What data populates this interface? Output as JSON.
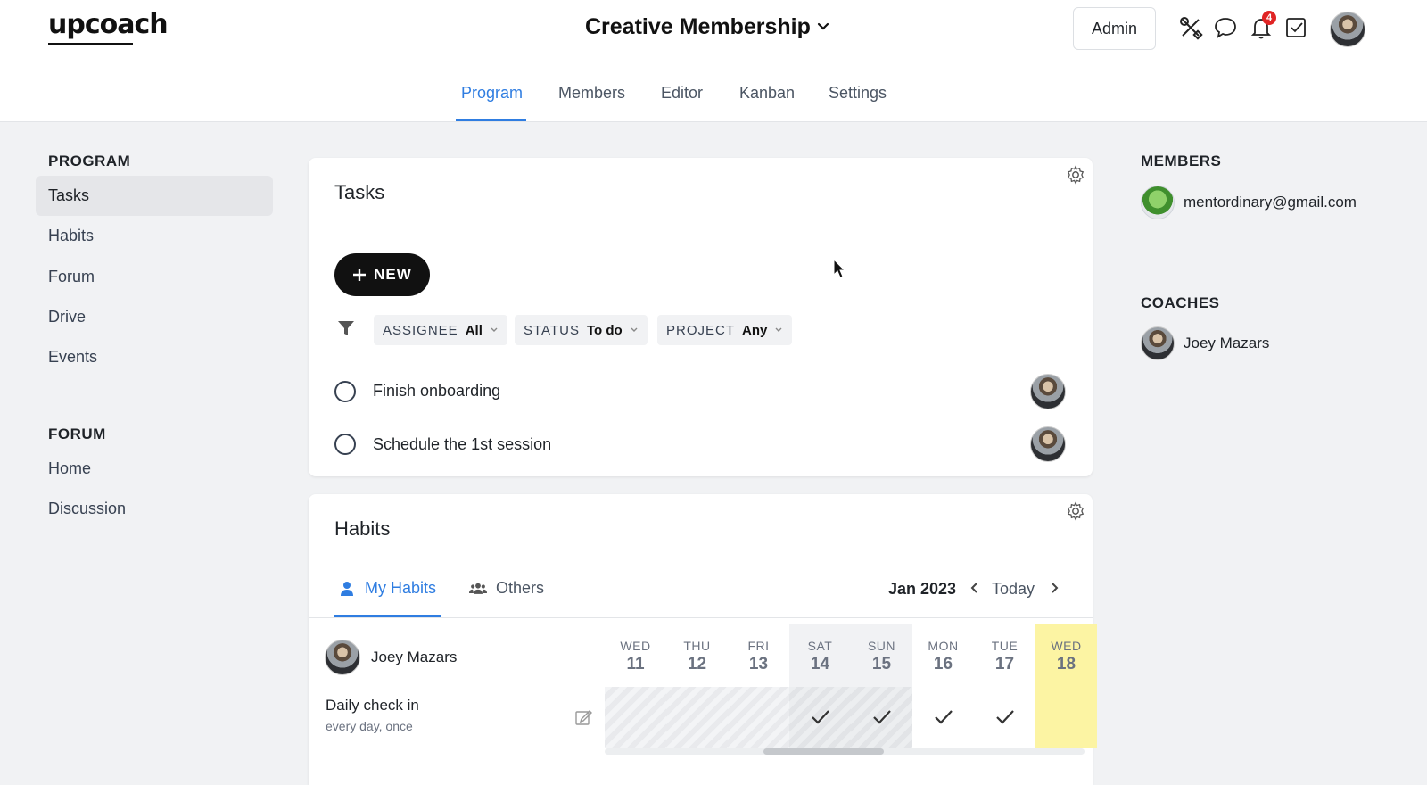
{
  "header": {
    "logo": "upcoach",
    "program_title": "Creative Membership",
    "admin_label": "Admin",
    "notification_count": "4",
    "icons": [
      "tools-icon",
      "chat-icon",
      "bell-icon",
      "checkbox-icon"
    ]
  },
  "nav_tabs": [
    {
      "label": "Program",
      "active": true
    },
    {
      "label": "Members"
    },
    {
      "label": "Editor"
    },
    {
      "label": "Kanban"
    },
    {
      "label": "Settings"
    }
  ],
  "sidebar": {
    "program_heading": "PROGRAM",
    "program_items": [
      {
        "label": "Tasks",
        "active": true
      },
      {
        "label": "Habits"
      },
      {
        "label": "Forum"
      },
      {
        "label": "Drive"
      },
      {
        "label": "Events"
      }
    ],
    "forum_heading": "FORUM",
    "forum_items": [
      {
        "label": "Home"
      },
      {
        "label": "Discussion"
      }
    ]
  },
  "tasks": {
    "title": "Tasks",
    "new_label": "NEW",
    "filters": [
      {
        "label": "ASSIGNEE",
        "value": "All"
      },
      {
        "label": "STATUS",
        "value": "To do"
      },
      {
        "label": "PROJECT",
        "value": "Any"
      }
    ],
    "items": [
      {
        "label": "Finish onboarding"
      },
      {
        "label": "Schedule the 1st session"
      }
    ]
  },
  "habits": {
    "title": "Habits",
    "tabs": [
      {
        "label": "My Habits",
        "active": true
      },
      {
        "label": "Others"
      }
    ],
    "month": "Jan 2023",
    "today_label": "Today",
    "user": "Joey Mazars",
    "habit": {
      "name": "Daily check in",
      "frequency": "every day, once"
    },
    "days": [
      {
        "name": "WED",
        "num": "11",
        "state": "past",
        "checked": false
      },
      {
        "name": "THU",
        "num": "12",
        "state": "past",
        "checked": false
      },
      {
        "name": "FRI",
        "num": "13",
        "state": "past",
        "checked": false
      },
      {
        "name": "SAT",
        "num": "14",
        "state": "weekend",
        "checked": true
      },
      {
        "name": "SUN",
        "num": "15",
        "state": "weekend",
        "checked": true
      },
      {
        "name": "MON",
        "num": "16",
        "state": "normal",
        "checked": true
      },
      {
        "name": "TUE",
        "num": "17",
        "state": "normal",
        "checked": true
      },
      {
        "name": "WED",
        "num": "18",
        "state": "today",
        "checked": false
      }
    ]
  },
  "members_panel": {
    "members_heading": "MEMBERS",
    "member_email": "mentordinary@gmail.com",
    "coaches_heading": "COACHES",
    "coach_name": "Joey Mazars"
  }
}
